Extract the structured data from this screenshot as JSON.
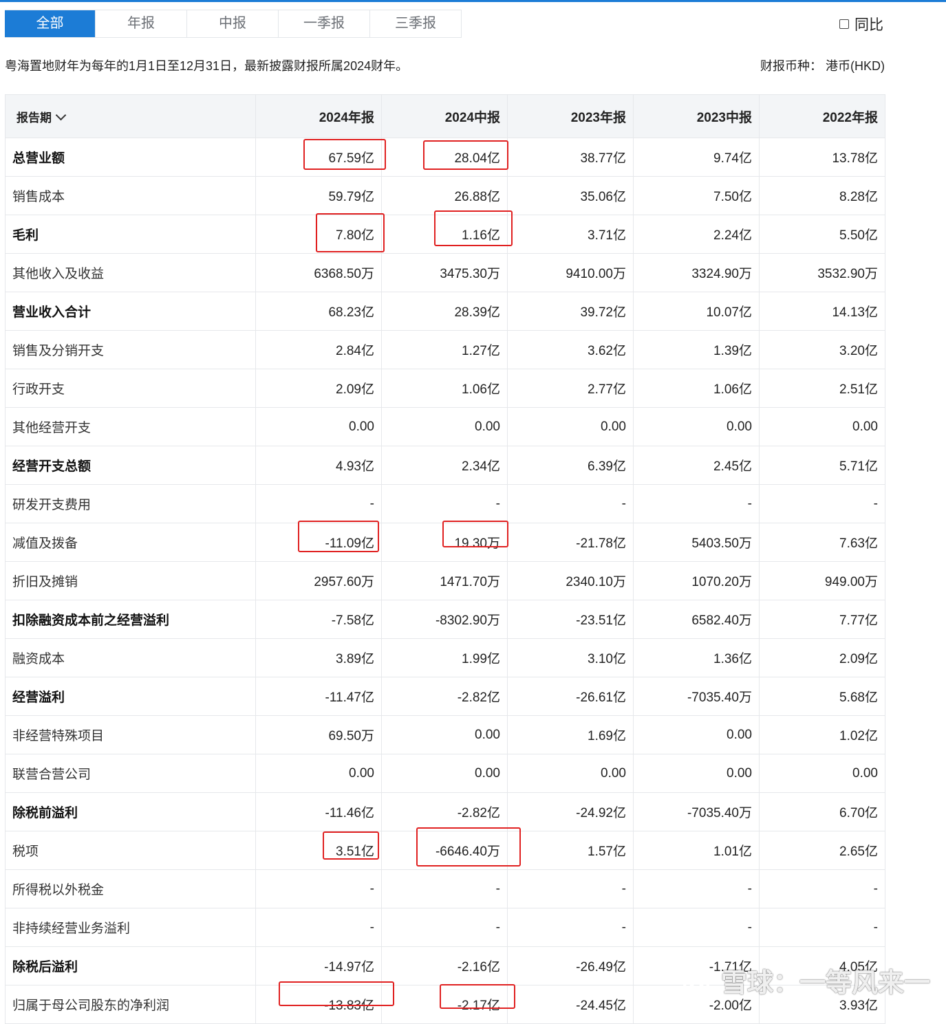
{
  "tabs": [
    {
      "label": "全部",
      "active": true
    },
    {
      "label": "年报",
      "active": false
    },
    {
      "label": "中报",
      "active": false
    },
    {
      "label": "一季报",
      "active": false
    },
    {
      "label": "三季报",
      "active": false
    }
  ],
  "yoy_checkbox": {
    "label": "同比",
    "checked": false
  },
  "fiscal_note": "粤海置地财年为每年的1月1日至12月31日，最新披露财报所属2024财年。",
  "currency": "财报币种：  港币(HKD)",
  "table": {
    "period_header": "报告期",
    "columns": [
      "2024年报",
      "2024中报",
      "2023年报",
      "2023中报",
      "2022年报"
    ],
    "rows": [
      {
        "label": "总营业额",
        "bold": true,
        "values": [
          "67.59亿",
          "28.04亿",
          "38.77亿",
          "9.74亿",
          "13.78亿"
        ]
      },
      {
        "label": "销售成本",
        "bold": false,
        "values": [
          "59.79亿",
          "26.88亿",
          "35.06亿",
          "7.50亿",
          "8.28亿"
        ]
      },
      {
        "label": "毛利",
        "bold": true,
        "values": [
          "7.80亿",
          "1.16亿",
          "3.71亿",
          "2.24亿",
          "5.50亿"
        ]
      },
      {
        "label": "其他收入及收益",
        "bold": false,
        "values": [
          "6368.50万",
          "3475.30万",
          "9410.00万",
          "3324.90万",
          "3532.90万"
        ]
      },
      {
        "label": "营业收入合计",
        "bold": true,
        "values": [
          "68.23亿",
          "28.39亿",
          "39.72亿",
          "10.07亿",
          "14.13亿"
        ]
      },
      {
        "label": "销售及分销开支",
        "bold": false,
        "values": [
          "2.84亿",
          "1.27亿",
          "3.62亿",
          "1.39亿",
          "3.20亿"
        ]
      },
      {
        "label": "行政开支",
        "bold": false,
        "values": [
          "2.09亿",
          "1.06亿",
          "2.77亿",
          "1.06亿",
          "2.51亿"
        ]
      },
      {
        "label": "其他经营开支",
        "bold": false,
        "values": [
          "0.00",
          "0.00",
          "0.00",
          "0.00",
          "0.00"
        ]
      },
      {
        "label": "经营开支总额",
        "bold": true,
        "values": [
          "4.93亿",
          "2.34亿",
          "6.39亿",
          "2.45亿",
          "5.71亿"
        ]
      },
      {
        "label": "研发开支费用",
        "bold": false,
        "values": [
          "-",
          "-",
          "-",
          "-",
          "-"
        ]
      },
      {
        "label": "减值及拨备",
        "bold": false,
        "values": [
          "-11.09亿",
          "19.30万",
          "-21.78亿",
          "5403.50万",
          "7.63亿"
        ]
      },
      {
        "label": "折旧及摊销",
        "bold": false,
        "values": [
          "2957.60万",
          "1471.70万",
          "2340.10万",
          "1070.20万",
          "949.00万"
        ]
      },
      {
        "label": "扣除融资成本前之经营溢利",
        "bold": true,
        "values": [
          "-7.58亿",
          "-8302.90万",
          "-23.51亿",
          "6582.40万",
          "7.77亿"
        ]
      },
      {
        "label": "融资成本",
        "bold": false,
        "values": [
          "3.89亿",
          "1.99亿",
          "3.10亿",
          "1.36亿",
          "2.09亿"
        ]
      },
      {
        "label": "经营溢利",
        "bold": true,
        "values": [
          "-11.47亿",
          "-2.82亿",
          "-26.61亿",
          "-7035.40万",
          "5.68亿"
        ]
      },
      {
        "label": "非经营特殊项目",
        "bold": false,
        "values": [
          "69.50万",
          "0.00",
          "1.69亿",
          "0.00",
          "1.02亿"
        ]
      },
      {
        "label": "联营合营公司",
        "bold": false,
        "values": [
          "0.00",
          "0.00",
          "0.00",
          "0.00",
          "0.00"
        ]
      },
      {
        "label": "除税前溢利",
        "bold": true,
        "values": [
          "-11.46亿",
          "-2.82亿",
          "-24.92亿",
          "-7035.40万",
          "6.70亿"
        ]
      },
      {
        "label": "税项",
        "bold": false,
        "values": [
          "3.51亿",
          "-6646.40万",
          "1.57亿",
          "1.01亿",
          "2.65亿"
        ]
      },
      {
        "label": "所得税以外税金",
        "bold": false,
        "values": [
          "-",
          "-",
          "-",
          "-",
          "-"
        ]
      },
      {
        "label": "非持续经营业务溢利",
        "bold": false,
        "values": [
          "-",
          "-",
          "-",
          "-",
          "-"
        ]
      },
      {
        "label": "除税后溢利",
        "bold": true,
        "values": [
          "-14.97亿",
          "-2.16亿",
          "-26.49亿",
          "-1.71亿",
          "4.05亿"
        ]
      },
      {
        "label": "归属于母公司股东的净利润",
        "bold": false,
        "values": [
          "-13.83亿",
          "-2.17亿",
          "-24.45亿",
          "-2.00亿",
          "3.93亿"
        ]
      }
    ]
  },
  "colors": {
    "accent": "#1c7cd6",
    "highlight": "#e02020",
    "header_bg": "#f3f5f7",
    "border": "#e6e8eb"
  },
  "watermark": {
    "text": "雪球：一等风来一",
    "icon": "snowball-logo-icon"
  }
}
